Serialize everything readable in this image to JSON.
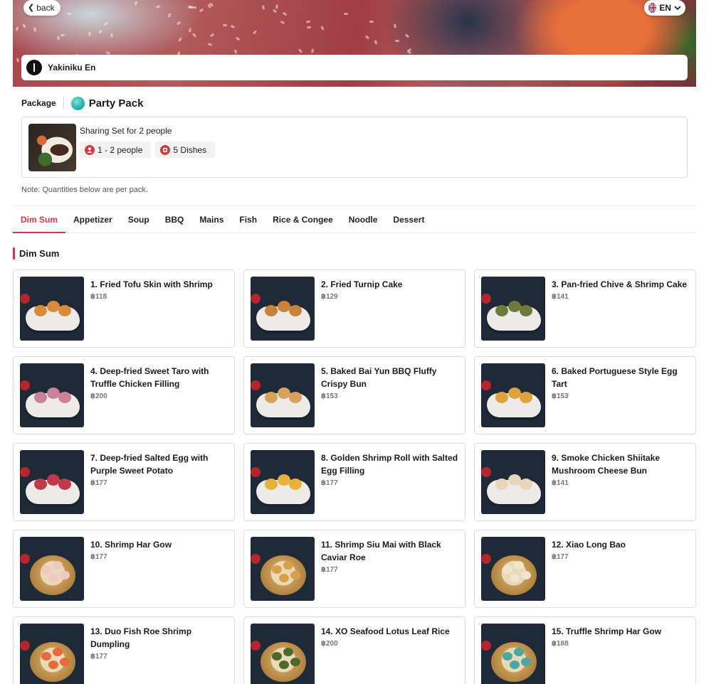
{
  "header": {
    "back_label": "back",
    "lang_label": "EN",
    "restaurant_name": "Yakiniku En"
  },
  "package": {
    "label": "Package",
    "name": "Party Pack",
    "title": "Sharing Set for 2 people",
    "people": "1 - 2 people",
    "dishes": "5 Dishes",
    "note": "Note: Quantities below are per pack."
  },
  "tabs": [
    "Dim Sum",
    "Appetizer",
    "Soup",
    "BBQ",
    "Mains",
    "Fish",
    "Rice & Congee",
    "Noodle",
    "Dessert"
  ],
  "active_tab": "Dim Sum",
  "section_title": "Dim Sum",
  "items": [
    {
      "name": "1. Fried Tofu Skin with Shrimp",
      "price": "฿118",
      "style": "plate",
      "food": "#d98a3a"
    },
    {
      "name": "2. Fried Turnip Cake",
      "price": "฿129",
      "style": "plate",
      "food": "#c9823a"
    },
    {
      "name": "3. Pan-fried Chive & Shrimp Cake",
      "price": "฿141",
      "style": "plate",
      "food": "#6f7a3a"
    },
    {
      "name": "4. Deep-fried Sweet Taro with Truffle Chicken Filling",
      "price": "฿200",
      "style": "plate",
      "food": "#c9829a"
    },
    {
      "name": "5. Baked Bai Yun BBQ Fluffy Crispy Bun",
      "price": "฿153",
      "style": "plate",
      "food": "#d7a35a"
    },
    {
      "name": "6. Baked Portuguese Style Egg Tart",
      "price": "฿153",
      "style": "plate",
      "food": "#e0a23c"
    },
    {
      "name": "7. Deep-fried Salted Egg with Purple Sweet Potato",
      "price": "฿177",
      "style": "plate",
      "food": "#c23a4a"
    },
    {
      "name": "8. Golden Shrimp Roll with Salted Egg Filling",
      "price": "฿177",
      "style": "plate",
      "food": "#e8b23a"
    },
    {
      "name": "9. Smoke Chicken Shiitake Mushroom Cheese Bun",
      "price": "฿141",
      "style": "plate",
      "food": "#e6d7b8"
    },
    {
      "name": "10. Shrimp Har Gow",
      "price": "฿177",
      "style": "bowl",
      "food": "#f0c8c0"
    },
    {
      "name": "11. Shrimp Siu Mai with Black Caviar Roe",
      "price": "฿177",
      "style": "bowl",
      "food": "#d9a04a"
    },
    {
      "name": "12. Xiao Long Bao",
      "price": "฿177",
      "style": "bowl",
      "food": "#efe4cc"
    },
    {
      "name": "13. Duo Fish Roe Shrimp Dumpling",
      "price": "฿177",
      "style": "bowl",
      "food": "#e86a3a"
    },
    {
      "name": "14. XO Seafood Lotus Leaf Rice",
      "price": "฿200",
      "style": "bowl",
      "food": "#4a6a2a"
    },
    {
      "name": "15. Truffle Shrimp Har Gow",
      "price": "฿188",
      "style": "bowl",
      "food": "#4aa8a0"
    }
  ],
  "colors": {
    "accent": "#d9363e",
    "teal": "#1fb4a6"
  }
}
